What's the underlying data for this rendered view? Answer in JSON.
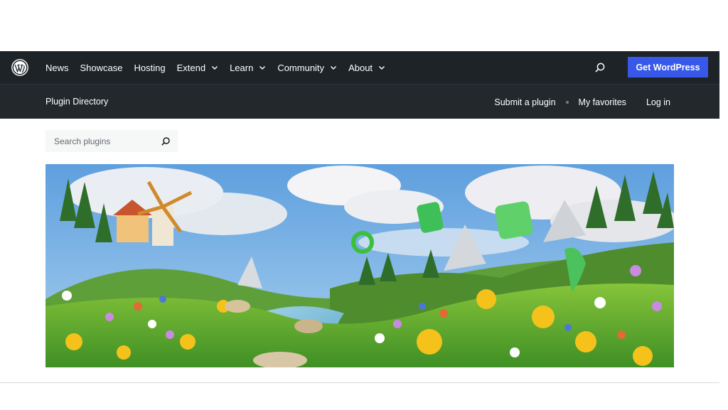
{
  "global_nav": {
    "logo_icon": "wordpress-logo-icon",
    "items": [
      {
        "label": "News",
        "has_dropdown": false
      },
      {
        "label": "Showcase",
        "has_dropdown": false
      },
      {
        "label": "Hosting",
        "has_dropdown": false
      },
      {
        "label": "Extend",
        "has_dropdown": true
      },
      {
        "label": "Learn",
        "has_dropdown": true
      },
      {
        "label": "Community",
        "has_dropdown": true
      },
      {
        "label": "About",
        "has_dropdown": true
      }
    ],
    "search_icon": "search-icon",
    "cta_label": "Get WordPress",
    "background": "#1d2327",
    "cta_color": "#3858e9"
  },
  "local_nav": {
    "title": "Plugin Directory",
    "links": {
      "submit": "Submit a plugin",
      "favorites": "My favorites",
      "login": "Log in"
    }
  },
  "search": {
    "placeholder": "Search plugins",
    "value": "",
    "icon": "search-icon"
  },
  "banner": {
    "kind": "illustration"
  }
}
